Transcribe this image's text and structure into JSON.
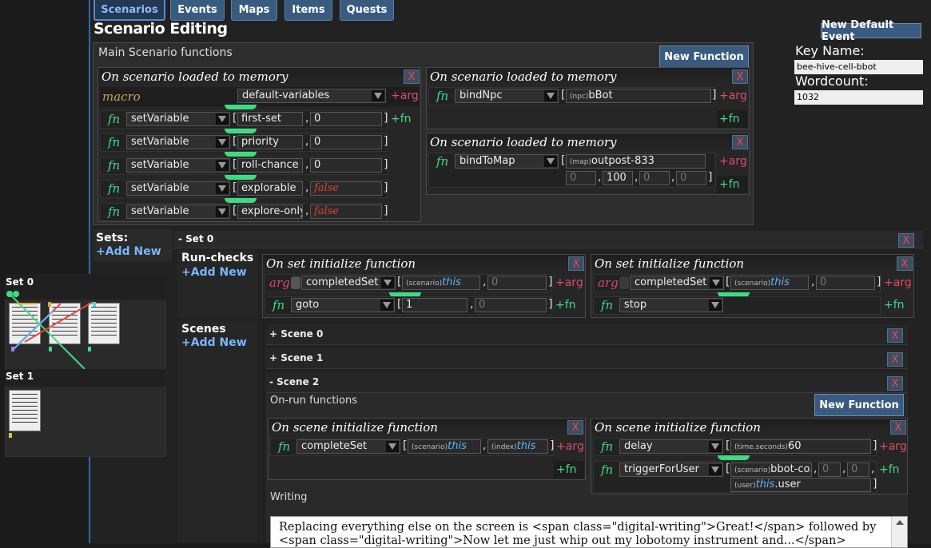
{
  "tabs": [
    {
      "label": "Scenarios",
      "active": true
    },
    {
      "label": "Events"
    },
    {
      "label": "Maps"
    },
    {
      "label": "Items"
    },
    {
      "label": "Quests"
    }
  ],
  "page_title": "Scenario Editing",
  "new_default_event": "New Default Event",
  "key_name": {
    "label": "Key Name:",
    "value": "bee-hive-cell-bbot"
  },
  "wordcount": {
    "label": "Wordcount:",
    "value": "1032"
  },
  "main": {
    "title": "Main Scenario functions",
    "new_function": "New Function",
    "f1": {
      "header": "On scenario loaded to memory",
      "macro": "macro",
      "macro_name": "default-variables",
      "rows": [
        {
          "fn": "fn",
          "name": "setVariable",
          "a1": "first-set",
          "a2": "0"
        },
        {
          "fn": "fn",
          "name": "setVariable",
          "a1": "priority",
          "a2": "0"
        },
        {
          "fn": "fn",
          "name": "setVariable",
          "a1": "roll-chance",
          "a2": "0"
        },
        {
          "fn": "fn",
          "name": "setVariable",
          "a1": "explorable",
          "a2": "false"
        },
        {
          "fn": "fn",
          "name": "setVariable",
          "a1": "explore-only",
          "a2": "false"
        }
      ]
    },
    "f2": {
      "header": "On scenario loaded to memory",
      "fn": "fn",
      "name": "bindNpc",
      "tag": "(npc)",
      "value": "bBot"
    },
    "f3": {
      "header": "On scenario loaded to memory",
      "fn": "fn",
      "name": "bindToMap",
      "tag": "(map)",
      "value": "outpost-833",
      "nums": [
        "0",
        "100",
        "0",
        "0"
      ]
    }
  },
  "x": "X",
  "plus_arg": "+arg",
  "plus_fn": "+fn",
  "sets": {
    "label": "Sets:",
    "add": "+Add New",
    "set0": "- Set 0"
  },
  "runchecks": {
    "label": "Run-checks",
    "add": "+Add New",
    "c1": {
      "header": "On set initialize function",
      "arg": "arg",
      "arg_name": "completedSet",
      "tag": "(scenario)",
      "kw": "this",
      "num": "0",
      "fn": "fn",
      "fn_name": "goto",
      "v1": "1",
      "v2": "0"
    },
    "c2": {
      "header": "On set initialize function",
      "arg": "arg",
      "arg_name": "completedSet",
      "tag": "(scenario)",
      "kw": "this",
      "num": "0",
      "fn": "fn",
      "fn_name": "stop"
    }
  },
  "scenes": {
    "label": "Scenes",
    "add": "+Add New",
    "s0": "+ Scene 0",
    "s1": "+ Scene 1",
    "s2": "- Scene 2",
    "onrun": "On-run functions",
    "new_function": "New Function",
    "sc1": {
      "header": "On scene initialize function",
      "fn": "fn",
      "name": "completeSet",
      "tag1": "(scenario)",
      "kw1": "this",
      "tag2": "(index)",
      "kw2": "this"
    },
    "sc2": {
      "header": "On scene initialize function",
      "fn": "fn",
      "name": "delay",
      "tag": "(time.seconds)",
      "val": "60",
      "fn2": "fn",
      "name2": "triggerForUser",
      "tag2": "(scenario)",
      "val2": "bbot-co...",
      "n1": "0",
      "n2": "0",
      "tag3": "(user)",
      "kw3": "this",
      ".user": ".user"
    },
    "writing": "Writing",
    "writing_text": "Replacing everything else on the screen is <span class=\"digital-writing\">Great!</span> followed by <span class=\"digital-writing\">Now let me just whip out my lobotomy instrument and...</span>"
  },
  "minimap": {
    "set0": "Set 0",
    "set1": "Set 1"
  }
}
